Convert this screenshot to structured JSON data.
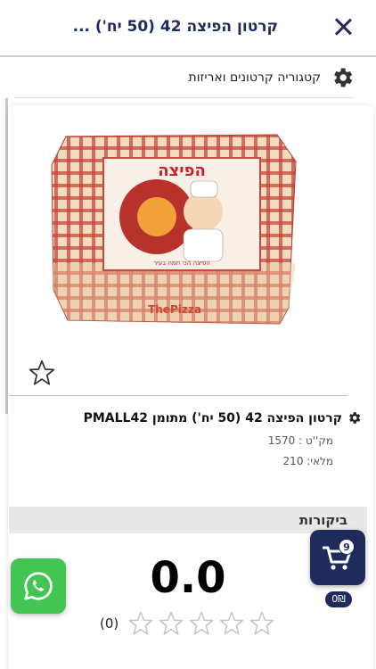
{
  "header": {
    "title": "קרטון הפיצה 42 (50 יח') ..."
  },
  "category": {
    "label": "קטגוריה קרטונים ואריזות"
  },
  "product": {
    "image_text": {
      "brand_top": "הפיצה",
      "tagline": "הפיצה הכי חמה בעיר",
      "side_brand": "ThePizza"
    },
    "name": "קרטון הפיצה 42 (50 יח') מתומן PMALL42",
    "sku": "מק''ט : 1570",
    "stock": "מלאי: 210"
  },
  "reviews": {
    "section_label": "ביקורות",
    "score": "0.0",
    "rating_stars": 0,
    "count": "(0)"
  },
  "cart": {
    "count": "9",
    "total": "0₪"
  },
  "colors": {
    "navy": "#1f2b5a",
    "whatsapp_green": "#43c553",
    "box_red": "#c8473a",
    "box_cream": "#f2dcc0"
  }
}
